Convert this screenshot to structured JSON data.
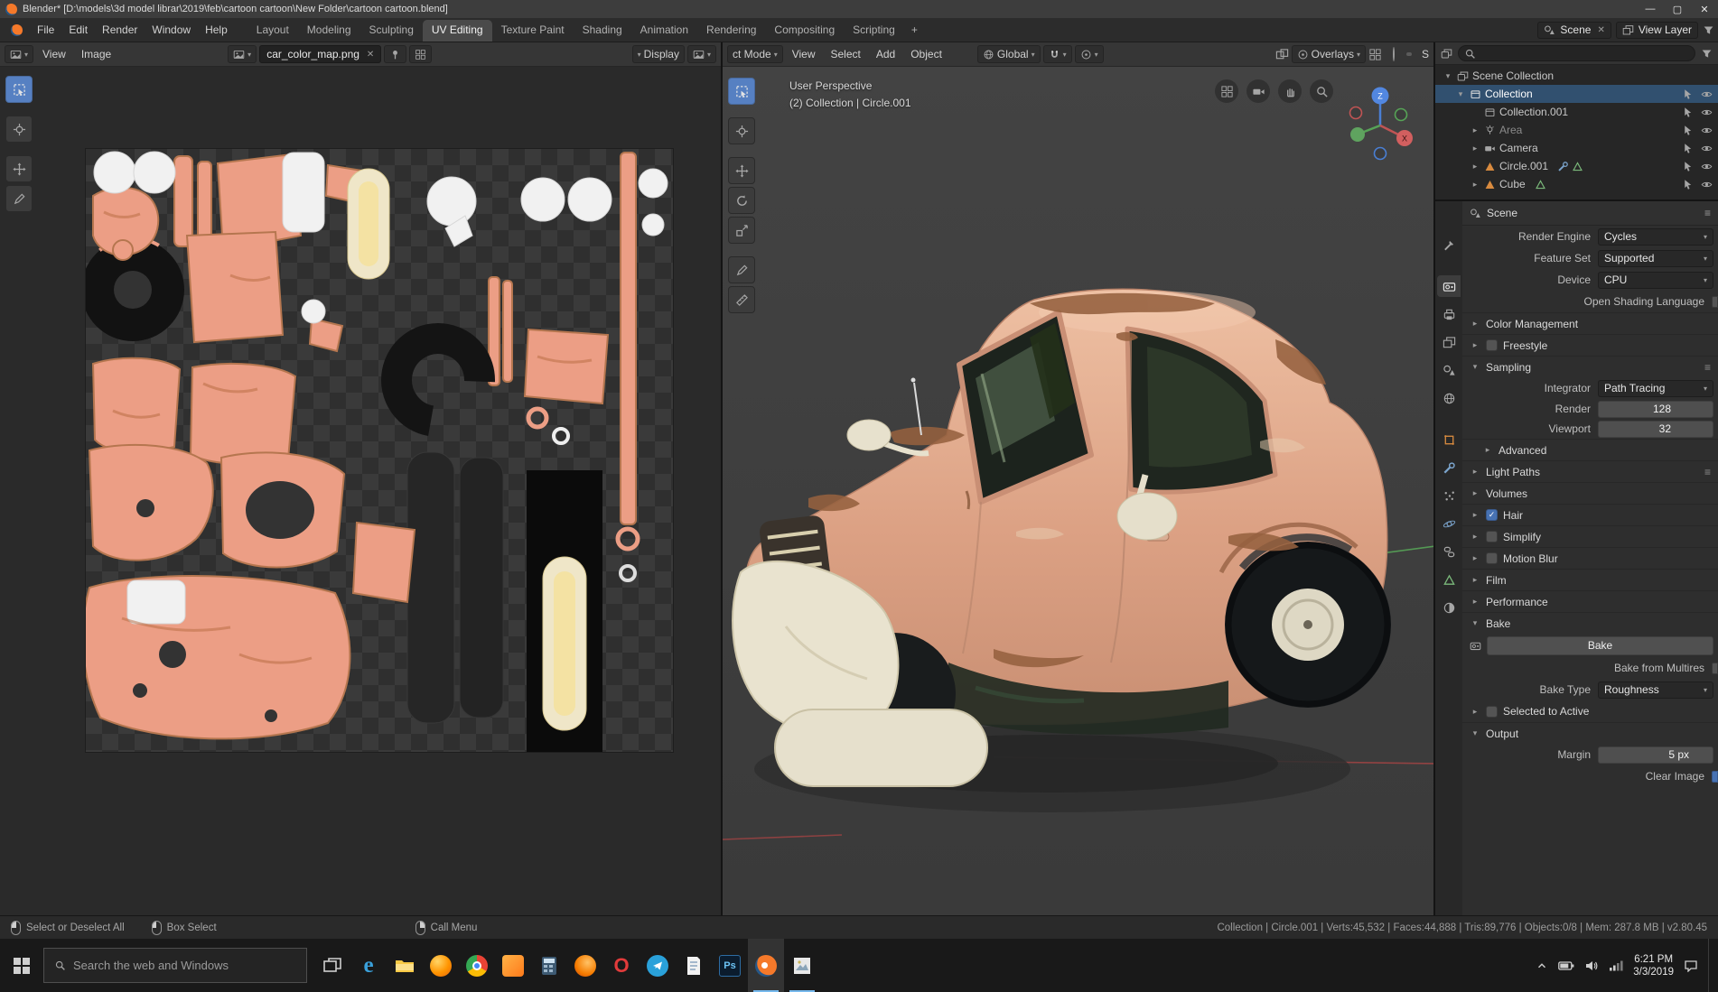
{
  "window": {
    "title": "Blender* [D:\\models\\3d model librar\\2019\\feb\\cartoon cartoon\\New Folder\\cartoon cartoon.blend]"
  },
  "topbar": {
    "menus": [
      "File",
      "Edit",
      "Render",
      "Window",
      "Help"
    ],
    "tabs": [
      "Layout",
      "Modeling",
      "Sculpting",
      "UV Editing",
      "Texture Paint",
      "Shading",
      "Animation",
      "Rendering",
      "Compositing",
      "Scripting"
    ],
    "plus": "+",
    "scene": "Scene",
    "view_layer": "View Layer"
  },
  "uv": {
    "menus": [
      "View",
      "Image"
    ],
    "image_name": "car_color_map.png",
    "display": "Display"
  },
  "view3d": {
    "mode": "ct Mode",
    "menus": [
      "View",
      "Select",
      "Add",
      "Object"
    ],
    "orientation": "Global",
    "overlays": "Overlays",
    "clip": "S",
    "overlay": {
      "line1": "User Perspective",
      "line2": "(2) Collection | Circle.001"
    },
    "gizmo": {
      "z": "Z",
      "x": "X"
    }
  },
  "outliner": {
    "items": [
      {
        "label": "Scene Collection"
      },
      {
        "label": "Collection"
      },
      {
        "label": "Collection.001"
      },
      {
        "label": "Area"
      },
      {
        "label": "Camera"
      },
      {
        "label": "Circle.001"
      },
      {
        "label": "Cube"
      }
    ]
  },
  "props": {
    "breadcrumb": "Scene",
    "render_engine": {
      "label": "Render Engine",
      "value": "Cycles"
    },
    "feature_set": {
      "label": "Feature Set",
      "value": "Supported"
    },
    "device": {
      "label": "Device",
      "value": "CPU"
    },
    "osl_label": "Open Shading Language",
    "panels": {
      "color_management": "Color Management",
      "freestyle": "Freestyle",
      "sampling": "Sampling",
      "advanced": "Advanced",
      "light_paths": "Light Paths",
      "volumes": "Volumes",
      "hair": "Hair",
      "simplify": "Simplify",
      "motion_blur": "Motion Blur",
      "film": "Film",
      "performance": "Performance",
      "bake": "Bake",
      "output": "Output"
    },
    "sampling": {
      "integrator_label": "Integrator",
      "integrator": "Path Tracing",
      "render_label": "Render",
      "render_value": "128",
      "viewport_label": "Viewport",
      "viewport_value": "32"
    },
    "bake": {
      "button": "Bake",
      "from_multires": "Bake from Multires",
      "type_label": "Bake Type",
      "type_value": "Roughness",
      "selected_to_active": "Selected to Active",
      "margin_label": "Margin",
      "margin_value": "5 px",
      "clear_image": "Clear Image"
    }
  },
  "status": {
    "select": "Select or Deselect All",
    "box": "Box Select",
    "menu": "Call Menu",
    "stats": "Collection | Circle.001 | Verts:45,532 | Faces:44,888 | Tris:89,776 | Objects:0/8 | Mem: 287.8 MB | v2.80.45"
  },
  "taskbar": {
    "search": "Search the web and Windows",
    "time": "6:21 PM",
    "date": "3/3/2019",
    "edge": "e",
    "opera": "O",
    "ps": "Ps"
  }
}
